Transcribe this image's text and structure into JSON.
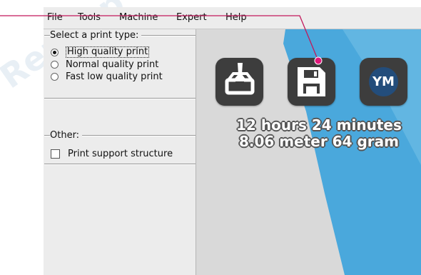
{
  "menu": {
    "file": "File",
    "tools": "Tools",
    "machine": "Machine",
    "expert": "Expert",
    "help": "Help"
  },
  "print_type": {
    "title": "Select a print type:",
    "options": [
      "High quality print",
      "Normal quality print",
      "Fast low quality print"
    ],
    "selected": "High quality print"
  },
  "other": {
    "title": "Other:",
    "support_label": "Print support structure",
    "support_checked": false
  },
  "toolbar": {
    "load_icon": "load-model-icon",
    "save_icon": "save-gcode-icon",
    "ym_label": "YM"
  },
  "estimate": {
    "time": "12 hours 24 minutes",
    "material": "8.06 meter 64 gram"
  },
  "colors": {
    "background": "#ececec",
    "viewer": "#d9d9d9",
    "blue_accent": "#4aa8dc",
    "callout": "#c2185b",
    "button": "#3d3d3d",
    "ym_badge": "#234d7b"
  }
}
